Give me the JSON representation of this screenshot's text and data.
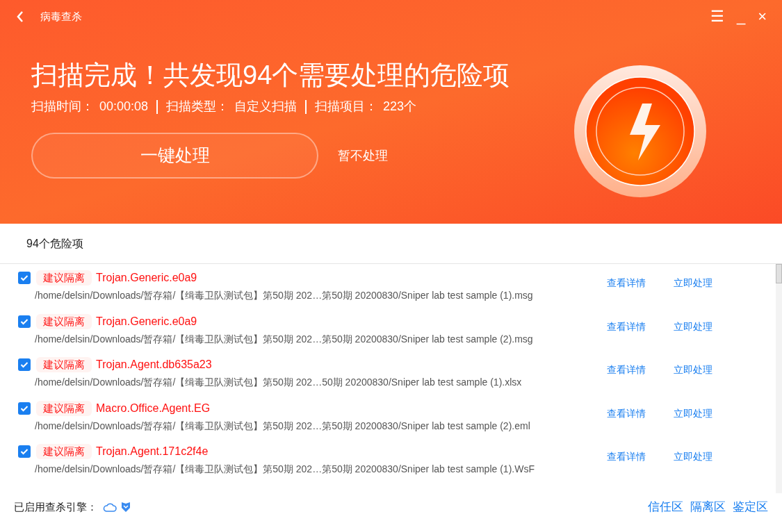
{
  "window": {
    "title": "病毒查杀",
    "controls": [
      "☰",
      "_",
      "×"
    ]
  },
  "summary": {
    "headline": "扫描完成！共发现94个需要处理的危险项",
    "stats": [
      {
        "label": "扫描时间：",
        "value": "00:00:08"
      },
      {
        "label": "扫描类型：",
        "value": "自定义扫描"
      },
      {
        "label": "扫描项目：",
        "value": "223个"
      }
    ],
    "primary_button": "一键处理",
    "secondary_button": "暂不处理"
  },
  "list": {
    "heading": "94个危险项",
    "rows": [
      {
        "checked": true,
        "tag": "建议隔离",
        "threat": "Trojan.Generic.e0a9",
        "path": "/home/delsin/Downloads/暂存箱/【缉毒卫队测试包】第50期 202…第50期 20200830/Sniper lab test sample (1).msg",
        "actions": [
          "查看详情",
          "立即处理"
        ]
      },
      {
        "checked": true,
        "tag": "建议隔离",
        "threat": "Trojan.Generic.e0a9",
        "path": "/home/delsin/Downloads/暂存箱/【缉毒卫队测试包】第50期 202…第50期 20200830/Sniper lab test sample (2).msg",
        "actions": [
          "查看详情",
          "立即处理"
        ]
      },
      {
        "checked": true,
        "tag": "建议隔离",
        "threat": "Trojan.Agent.db635a23",
        "path": "/home/delsin/Downloads/暂存箱/【缉毒卫队测试包】第50期 202…50期 20200830/Sniper lab test sample (1).xlsx",
        "actions": [
          "查看详情",
          "立即处理"
        ]
      },
      {
        "checked": true,
        "tag": "建议隔离",
        "threat": "Macro.Office.Agent.EG",
        "path": "/home/delsin/Downloads/暂存箱/【缉毒卫队测试包】第50期 202…第50期 20200830/Sniper lab test sample (2).eml",
        "actions": [
          "查看详情",
          "立即处理"
        ]
      },
      {
        "checked": true,
        "tag": "建议隔离",
        "threat": "Trojan.Agent.171c2f4e",
        "path": "/home/delsin/Downloads/暂存箱/【缉毒卫队测试包】第50期 202…第50期 20200830/Sniper lab test sample (1).WsF",
        "actions": [
          "查看详情",
          "立即处理"
        ]
      }
    ]
  },
  "footer": {
    "engines_label": "已启用查杀引擎：",
    "links": [
      "信任区",
      "隔离区",
      "鉴定区"
    ]
  }
}
